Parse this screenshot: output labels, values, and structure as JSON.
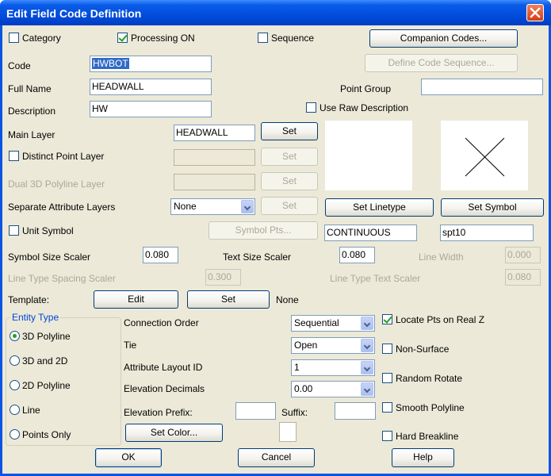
{
  "window": {
    "title": "Edit Field Code Definition"
  },
  "checks": {
    "category": {
      "label": "Category",
      "checked": false
    },
    "processing_on": {
      "label": "Processing ON",
      "checked": true
    },
    "sequence": {
      "label": "Sequence",
      "checked": false
    },
    "use_raw_description": {
      "label": "Use Raw Description",
      "checked": false
    },
    "distinct_point_layer": {
      "label": "Distinct Point Layer",
      "checked": false
    },
    "unit_symbol": {
      "label": "Unit Symbol",
      "checked": false
    },
    "locate_pts_real_z": {
      "label": "Locate Pts on Real Z",
      "checked": true
    },
    "non_surface": {
      "label": "Non-Surface",
      "checked": false
    },
    "random_rotate": {
      "label": "Random Rotate",
      "checked": false
    },
    "smooth_polyline": {
      "label": "Smooth Polyline",
      "checked": false
    },
    "hard_breakline": {
      "label": "Hard Breakline",
      "checked": false
    }
  },
  "buttons": {
    "companion_codes": "Companion Codes...",
    "define_code_sequence": "Define Code Sequence...",
    "set": "Set",
    "set_linetype": "Set Linetype",
    "set_symbol": "Set Symbol",
    "symbol_pts": "Symbol Pts...",
    "edit": "Edit",
    "set_color": "Set Color...",
    "ok": "OK",
    "cancel": "Cancel",
    "help": "Help"
  },
  "fields": {
    "code": {
      "label": "Code",
      "value": "HWBOT"
    },
    "full_name": {
      "label": "Full Name",
      "value": "HEADWALL"
    },
    "description": {
      "label": "Description",
      "value": "HW"
    },
    "point_group": {
      "label": "Point Group",
      "value": ""
    },
    "main_layer": {
      "label": "Main Layer",
      "value": "HEADWALL"
    },
    "dual_3d_polyline_layer": {
      "label": "Dual 3D Polyline Layer",
      "value": ""
    },
    "separate_attribute_layers": {
      "label": "Separate Attribute Layers",
      "value": "None"
    },
    "linetype": {
      "value": "CONTINUOUS"
    },
    "symbol": {
      "value": "spt10"
    },
    "symbol_size_scaler": {
      "label": "Symbol Size Scaler",
      "value": "0.080"
    },
    "text_size_scaler": {
      "label": "Text Size Scaler",
      "value": "0.080"
    },
    "line_width": {
      "label": "Line Width",
      "value": "0.000"
    },
    "line_type_spacing_scaler": {
      "label": "Line Type Spacing Scaler",
      "value": "0.300"
    },
    "line_type_text_scaler": {
      "label": "Line Type Text Scaler",
      "value": "0.080"
    },
    "template": {
      "label": "Template:",
      "value": "None"
    }
  },
  "entity_type": {
    "title": "Entity Type",
    "options": [
      "3D Polyline",
      "3D and 2D",
      "2D Polyline",
      "Line",
      "Points Only"
    ],
    "selected": "3D Polyline"
  },
  "connection": {
    "connection_order": {
      "label": "Connection Order",
      "value": "Sequential"
    },
    "tie": {
      "label": "Tie",
      "value": "Open"
    },
    "attribute_layout_id": {
      "label": "Attribute Layout ID",
      "value": "1"
    },
    "elevation_decimals": {
      "label": "Elevation Decimals",
      "value": "0.00"
    },
    "elevation_prefix": {
      "label": "Elevation Prefix:",
      "value": ""
    },
    "suffix": {
      "label": "Suffix:",
      "value": ""
    }
  },
  "colors": {
    "title_bar": "#0a54e3",
    "dialog_bg": "#ece9d8",
    "check_mark": "#21a121",
    "selection": "#316ac5",
    "group_title": "#0046d5"
  },
  "icons": {
    "close": "close-icon",
    "symbol_preview": "x-symbol-icon",
    "dropdown": "chevron-down-icon"
  }
}
